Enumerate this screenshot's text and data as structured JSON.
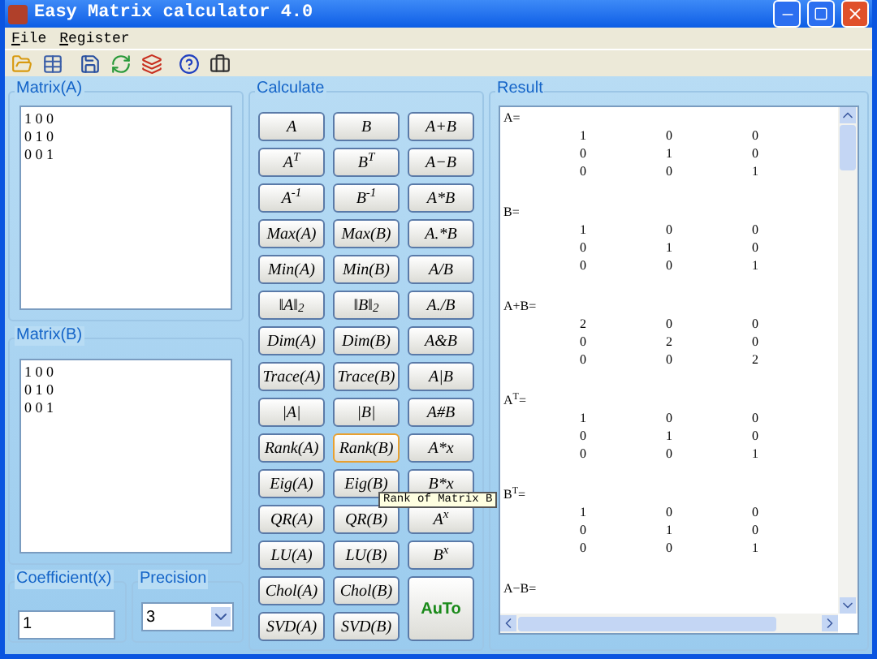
{
  "window": {
    "title": "Easy Matrix calculator 4.0"
  },
  "menu": [
    {
      "label": "File"
    },
    {
      "label": "Register"
    }
  ],
  "matrix_a": {
    "title": "Matrix(A)",
    "value": "1 0 0\n0 1 0\n0 0 1"
  },
  "matrix_b": {
    "title": "Matrix(B)",
    "value": "1 0 0\n0 1 0\n0 0 1"
  },
  "coefficient": {
    "title": "Coefficient(x)",
    "value": "1"
  },
  "precision": {
    "title": "Precision",
    "value": "3"
  },
  "calculate": {
    "title": "Calculate",
    "buttons": [
      {
        "label": "A",
        "kind": "normal",
        "hovered": false
      },
      {
        "label": "B",
        "kind": "normal",
        "hovered": false
      },
      {
        "label": "A+B",
        "kind": "normal",
        "hovered": false
      },
      {
        "label": "A$^{T}$",
        "kind": "normal",
        "hovered": false
      },
      {
        "label": "B$^{T}$",
        "kind": "normal",
        "hovered": false
      },
      {
        "label": "A−B",
        "kind": "normal",
        "hovered": false
      },
      {
        "label": "A$^{-1}$",
        "kind": "normal",
        "hovered": false
      },
      {
        "label": "B$^{-1}$",
        "kind": "normal",
        "hovered": false
      },
      {
        "label": "A*B",
        "kind": "normal",
        "hovered": false
      },
      {
        "label": "Max(A)",
        "kind": "normal",
        "hovered": false
      },
      {
        "label": "Max(B)",
        "kind": "normal",
        "hovered": false
      },
      {
        "label": "A.*B",
        "kind": "normal",
        "hovered": false
      },
      {
        "label": "Min(A)",
        "kind": "normal",
        "hovered": false
      },
      {
        "label": "Min(B)",
        "kind": "normal",
        "hovered": false
      },
      {
        "label": "A/B",
        "kind": "normal",
        "hovered": false
      },
      {
        "label": "‖A‖$_{2}$",
        "kind": "normal",
        "hovered": false
      },
      {
        "label": "‖B‖$_{2}$",
        "kind": "normal",
        "hovered": false
      },
      {
        "label": "A./B",
        "kind": "normal",
        "hovered": false
      },
      {
        "label": "Dim(A)",
        "kind": "normal",
        "hovered": false
      },
      {
        "label": "Dim(B)",
        "kind": "normal",
        "hovered": false
      },
      {
        "label": "A&B",
        "kind": "normal",
        "hovered": false
      },
      {
        "label": "Trace(A)",
        "kind": "normal",
        "hovered": false
      },
      {
        "label": "Trace(B)",
        "kind": "normal",
        "hovered": false
      },
      {
        "label": "A|B",
        "kind": "normal",
        "hovered": false
      },
      {
        "label": "|A|",
        "kind": "normal",
        "hovered": false
      },
      {
        "label": "|B|",
        "kind": "normal",
        "hovered": false
      },
      {
        "label": "A#B",
        "kind": "normal",
        "hovered": false
      },
      {
        "label": "Rank(A)",
        "kind": "normal",
        "hovered": false
      },
      {
        "label": "Rank(B)",
        "kind": "normal",
        "hovered": true
      },
      {
        "label": "A*x",
        "kind": "normal",
        "hovered": false
      },
      {
        "label": "Eig(A)",
        "kind": "normal",
        "hovered": false
      },
      {
        "label": "Eig(B)",
        "kind": "normal",
        "hovered": false
      },
      {
        "label": "B*x",
        "kind": "normal",
        "hovered": false
      },
      {
        "label": "QR(A)",
        "kind": "normal",
        "hovered": false
      },
      {
        "label": "QR(B)",
        "kind": "normal",
        "hovered": false
      },
      {
        "label": "A$^{x}$",
        "kind": "normal",
        "hovered": false
      },
      {
        "label": "LU(A)",
        "kind": "normal",
        "hovered": false
      },
      {
        "label": "LU(B)",
        "kind": "normal",
        "hovered": false
      },
      {
        "label": "B$^{x}$",
        "kind": "normal",
        "hovered": false
      },
      {
        "label": "Chol(A)",
        "kind": "normal",
        "hovered": false
      },
      {
        "label": "Chol(B)",
        "kind": "normal",
        "hovered": false
      },
      {
        "label": "AuTo",
        "kind": "big",
        "hovered": false
      },
      {
        "label": "SVD(A)",
        "kind": "normal",
        "hovered": false
      },
      {
        "label": "SVD(B)",
        "kind": "normal",
        "hovered": false
      }
    ]
  },
  "tooltip": {
    "text": "Rank of Matrix B"
  },
  "result": {
    "title": "Result",
    "blocks": [
      {
        "label": "A=",
        "rows": [
          [
            "1",
            "0",
            "0"
          ],
          [
            "0",
            "1",
            "0"
          ],
          [
            "0",
            "0",
            "1"
          ]
        ]
      },
      {
        "label": "B=",
        "rows": [
          [
            "1",
            "0",
            "0"
          ],
          [
            "0",
            "1",
            "0"
          ],
          [
            "0",
            "0",
            "1"
          ]
        ]
      },
      {
        "label": "A+B=",
        "rows": [
          [
            "2",
            "0",
            "0"
          ],
          [
            "0",
            "2",
            "0"
          ],
          [
            "0",
            "0",
            "2"
          ]
        ]
      },
      {
        "label": "A$^{T}$=",
        "rows": [
          [
            "1",
            "0",
            "0"
          ],
          [
            "0",
            "1",
            "0"
          ],
          [
            "0",
            "0",
            "1"
          ]
        ]
      },
      {
        "label": "B$^{T}$=",
        "rows": [
          [
            "1",
            "0",
            "0"
          ],
          [
            "0",
            "1",
            "0"
          ],
          [
            "0",
            "0",
            "1"
          ]
        ]
      },
      {
        "label": "A−B="
      }
    ]
  }
}
